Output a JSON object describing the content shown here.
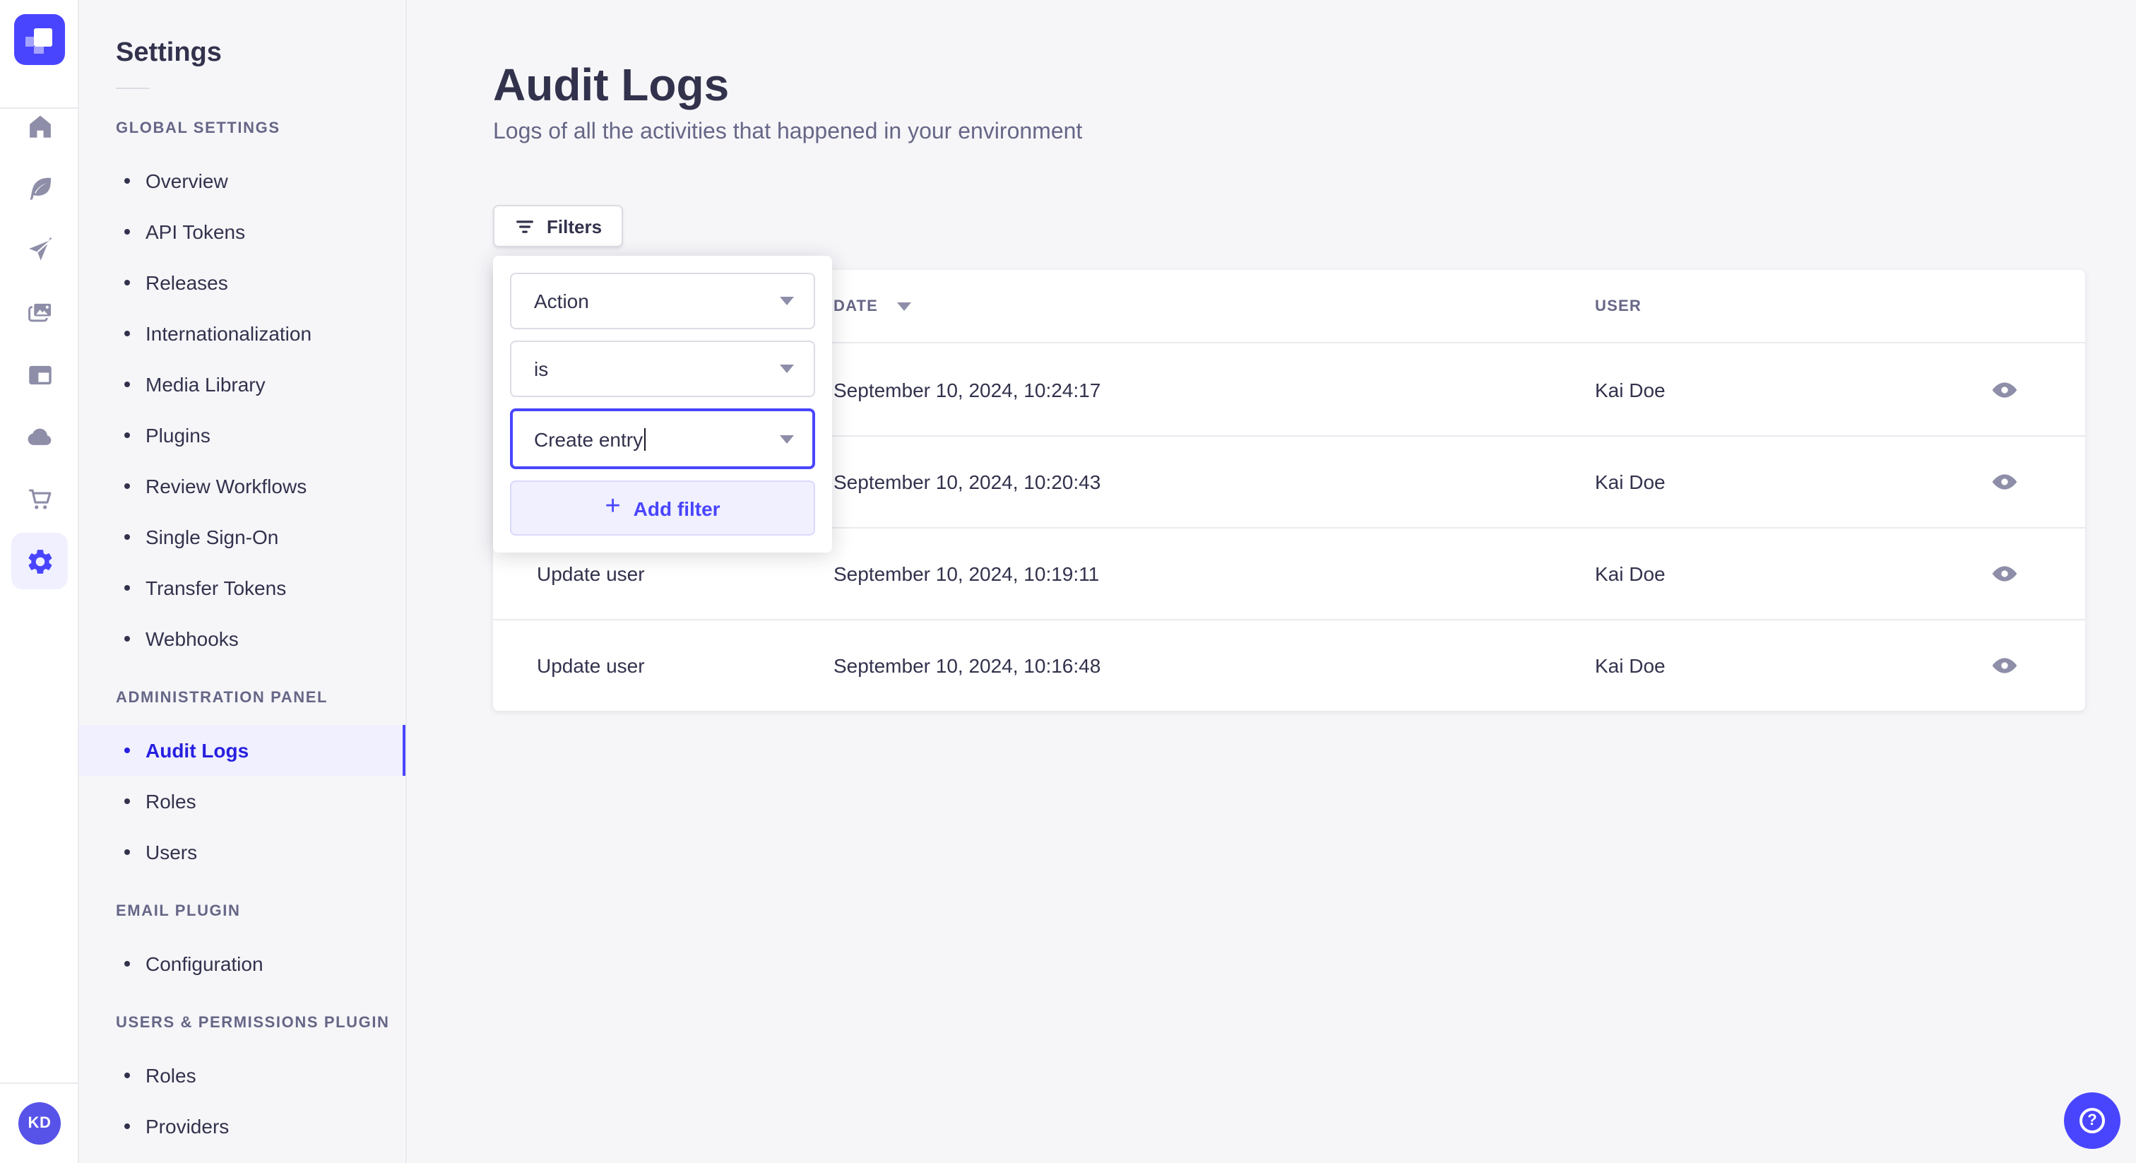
{
  "rail": {
    "logo_icon": "strapi-logo",
    "icons": [
      "home",
      "feather",
      "paper-plane",
      "images",
      "layout",
      "cloud",
      "cart",
      "gear"
    ],
    "active_icon": "gear",
    "avatar_initials": "KD"
  },
  "sidebar": {
    "title": "Settings",
    "sections": [
      {
        "label": "GLOBAL SETTINGS",
        "items": [
          "Overview",
          "API Tokens",
          "Releases",
          "Internationalization",
          "Media Library",
          "Plugins",
          "Review Workflows",
          "Single Sign-On",
          "Transfer Tokens",
          "Webhooks"
        ]
      },
      {
        "label": "ADMINISTRATION PANEL",
        "active_item": "Audit Logs",
        "items": [
          "Audit Logs",
          "Roles",
          "Users"
        ]
      },
      {
        "label": "EMAIL PLUGIN",
        "items": [
          "Configuration"
        ]
      },
      {
        "label": "USERS & PERMISSIONS PLUGIN",
        "items": [
          "Roles",
          "Providers"
        ]
      }
    ]
  },
  "page": {
    "title": "Audit Logs",
    "subtitle": "Logs of all the activities that happened in your environment"
  },
  "toolbar": {
    "filters_label": "Filters"
  },
  "filter_popover": {
    "attribute_value": "Action",
    "operator_value": "is",
    "value_input": "Create entry",
    "plus_icon": "+",
    "add_filter_label": "Add filter"
  },
  "table": {
    "headers": {
      "action": "",
      "date": "DATE",
      "user": "USER"
    },
    "sort": {
      "column": "DATE",
      "direction": "desc"
    },
    "rows": [
      {
        "action": "",
        "date": "September 10, 2024, 10:24:17",
        "user": "Kai Doe"
      },
      {
        "action": "",
        "date": "September 10, 2024, 10:20:43",
        "user": "Kai Doe"
      },
      {
        "action": "Update user",
        "date": "September 10, 2024, 10:19:11",
        "user": "Kai Doe"
      },
      {
        "action": "Update user",
        "date": "September 10, 2024, 10:16:48",
        "user": "Kai Doe"
      }
    ]
  },
  "help": {
    "icon_glyph": "?"
  },
  "colors": {
    "accent": "#4945ff",
    "accent_light": "#f0f0ff",
    "active_link": "#271fe0",
    "text": "#32324d",
    "muted": "#666687",
    "border": "#eaeaef",
    "input_border": "#dcdce4",
    "icon": "#8e8ea9",
    "background": "#f6f6f9"
  }
}
